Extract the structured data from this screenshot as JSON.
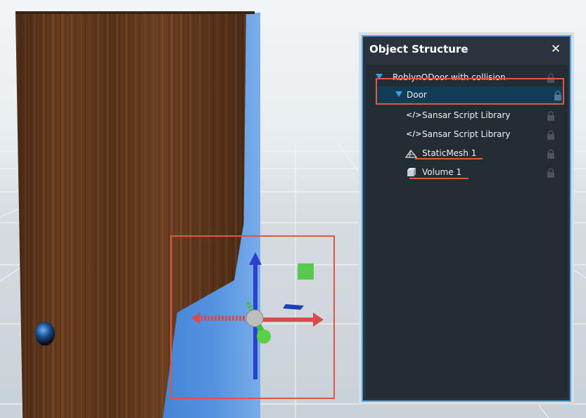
{
  "viewport": {
    "name": "3D viewport"
  },
  "panel": {
    "title": "Object Structure",
    "close_label": "✕",
    "items": [
      {
        "label": "RoblynODoor with collision",
        "icon": "expand-arrow-icon",
        "level": 0,
        "locked": true
      },
      {
        "label": "Door",
        "icon": "expand-arrow-icon",
        "level": 1,
        "locked": true,
        "selected": true
      },
      {
        "label": "Sansar Script Library",
        "icon": "code-icon",
        "level": 2,
        "locked": true
      },
      {
        "label": "Sansar Script Library",
        "icon": "code-icon",
        "level": 2,
        "locked": true
      },
      {
        "label": "StaticMesh 1",
        "icon": "mesh-icon",
        "level": 2,
        "locked": true
      },
      {
        "label": "Volume 1",
        "icon": "volume-icon",
        "level": 2,
        "locked": true
      }
    ]
  },
  "colors": {
    "panel_bg": "#2b343c",
    "tree_bg": "#232c33",
    "accent_blue": "#3b9ee8",
    "highlight_red": "#e4553d",
    "selected_row": "#0f3d55"
  }
}
